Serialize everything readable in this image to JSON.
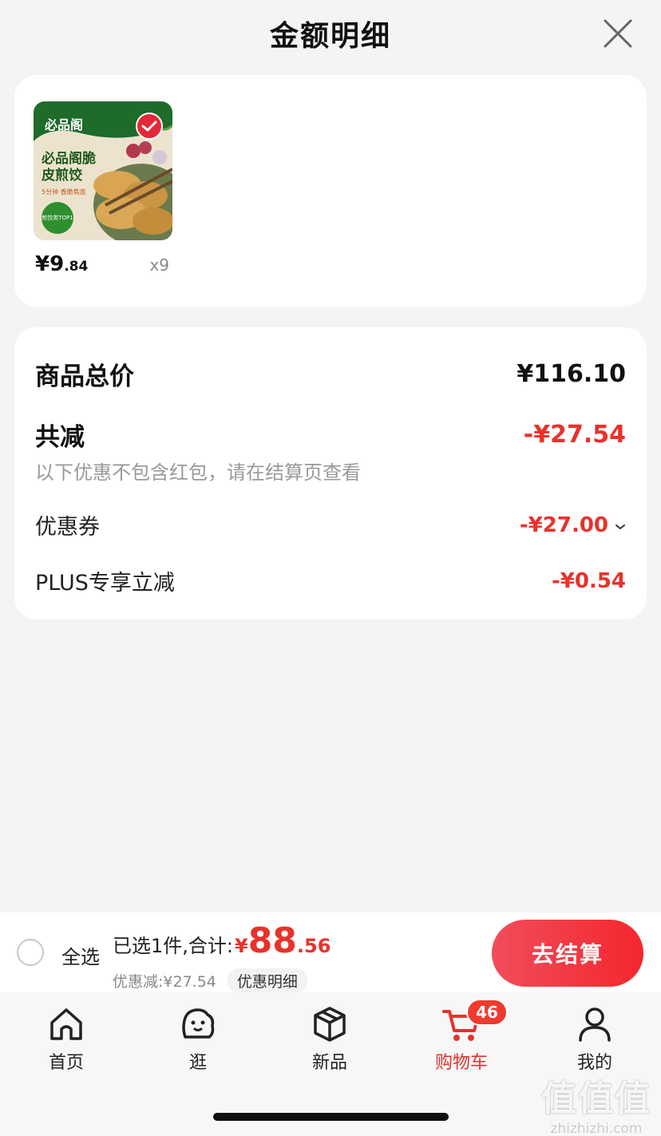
{
  "header": {
    "title": "金额明细"
  },
  "product": {
    "thumb": {
      "brand": "必品阁",
      "name": "必品阁脆皮煎饺",
      "sub": "5分钟 香脆焦底",
      "badge": "煎饺类TOP1"
    },
    "price_symbol": "¥",
    "price_int": "9",
    "price_dec": ".84",
    "quantity": "x9"
  },
  "summary": {
    "total_label": "商品总价",
    "total_value": "¥116.10",
    "reduce_label": "共减",
    "reduce_value": "-¥27.54",
    "note": "以下优惠不包含红包，请在结算页查看",
    "coupon_label": "优惠券",
    "coupon_value": "-¥27.00",
    "plus_label": "PLUS专享立减",
    "plus_value": "-¥0.54"
  },
  "checkout": {
    "select_all": "全选",
    "selected_text": "已选1件,合计:",
    "yen": "¥",
    "total_int": "88",
    "total_dec": ".56",
    "discount_text": "优惠减:¥27.54",
    "detail_button": "优惠明细",
    "pay_button": "去结算"
  },
  "tabbar": {
    "home": "首页",
    "browse": "逛",
    "new": "新品",
    "cart": "购物车",
    "cart_badge": "46",
    "mine": "我的"
  },
  "watermark": {
    "logo": "值值值",
    "url": "zhizhizhi.com"
  },
  "colors": {
    "accent": "#e8322b",
    "pay_button": "#f3262e",
    "background": "#f4f4f4"
  }
}
